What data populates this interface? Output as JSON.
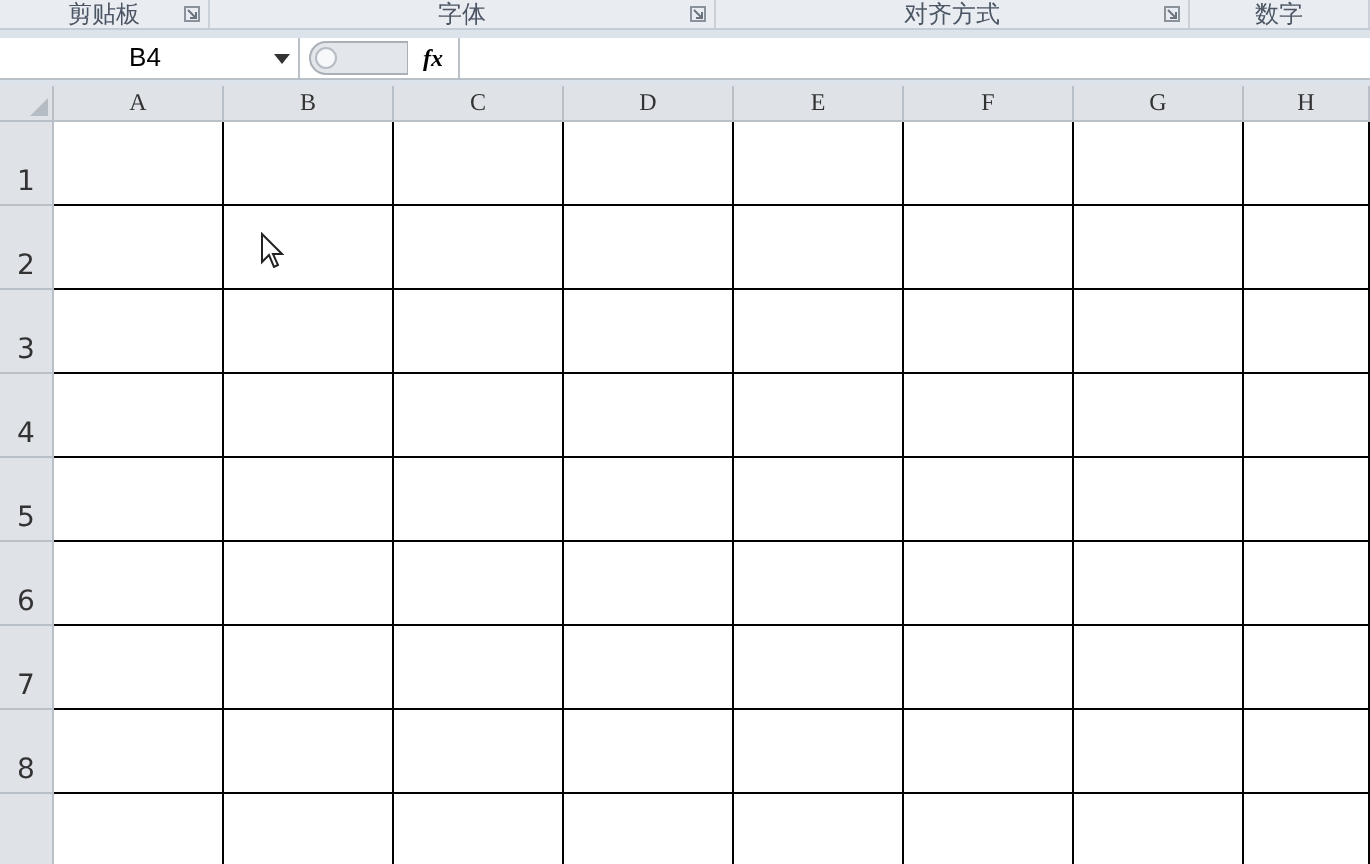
{
  "ribbon_groups": [
    {
      "label": "剪贴板",
      "launcher": true
    },
    {
      "label": "字体",
      "launcher": true
    },
    {
      "label": "对齐方式",
      "launcher": true
    },
    {
      "label": "数字",
      "launcher": false
    }
  ],
  "name_box": {
    "value": "B4"
  },
  "formula_bar": {
    "fx": "fx"
  },
  "columns": [
    "A",
    "B",
    "C",
    "D",
    "E",
    "F",
    "G",
    "H"
  ],
  "rows": [
    "1",
    "2",
    "3",
    "4",
    "5",
    "6",
    "7",
    "8"
  ]
}
